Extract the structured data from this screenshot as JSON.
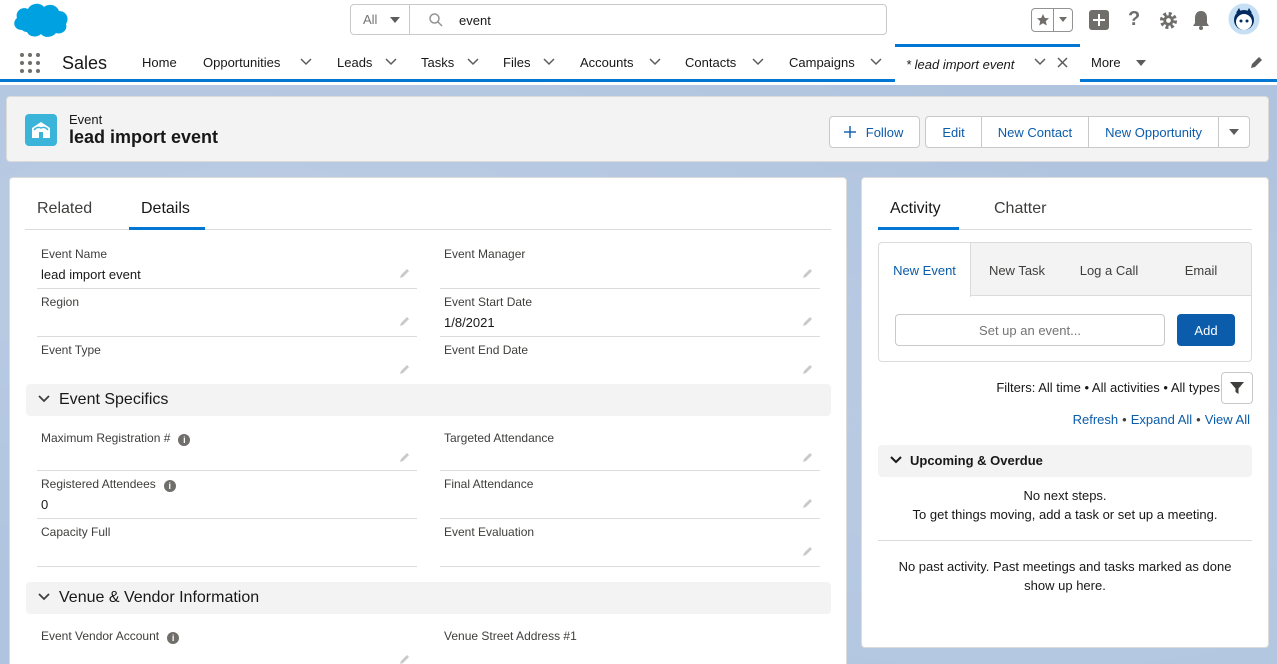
{
  "header": {
    "search_scope": "All",
    "search_value": "event"
  },
  "nav": {
    "app_name": "Sales",
    "items": [
      {
        "label": "Home"
      },
      {
        "label": "Opportunities"
      },
      {
        "label": "Leads"
      },
      {
        "label": "Tasks"
      },
      {
        "label": "Files"
      },
      {
        "label": "Accounts"
      },
      {
        "label": "Contacts"
      },
      {
        "label": "Campaigns"
      }
    ],
    "active_tab": "* lead import event",
    "more": "More"
  },
  "record": {
    "type": "Event",
    "title": "lead import event",
    "buttons": {
      "follow": "Follow",
      "edit": "Edit",
      "new_contact": "New Contact",
      "new_opportunity": "New Opportunity"
    }
  },
  "details": {
    "tabs": [
      "Related",
      "Details"
    ],
    "fields": {
      "event_name": {
        "label": "Event Name",
        "value": "lead import event"
      },
      "event_manager": {
        "label": "Event Manager",
        "value": ""
      },
      "region": {
        "label": "Region",
        "value": ""
      },
      "event_start_date": {
        "label": "Event Start Date",
        "value": "1/8/2021"
      },
      "event_type": {
        "label": "Event Type",
        "value": ""
      },
      "event_end_date": {
        "label": "Event End Date",
        "value": ""
      }
    },
    "section_specifics": {
      "title": "Event Specifics",
      "max_registration": {
        "label": "Maximum Registration #",
        "value": ""
      },
      "targeted_attendance": {
        "label": "Targeted Attendance",
        "value": ""
      },
      "registered_attendees": {
        "label": "Registered Attendees",
        "value": "0"
      },
      "final_attendance": {
        "label": "Final Attendance",
        "value": ""
      },
      "capacity_full": {
        "label": "Capacity Full",
        "value": ""
      },
      "event_evaluation": {
        "label": "Event Evaluation",
        "value": ""
      }
    },
    "section_venue": {
      "title": "Venue & Vendor Information",
      "vendor_account": {
        "label": "Event Vendor Account",
        "value": ""
      },
      "venue_street": {
        "label": "Venue Street Address #1",
        "value": ""
      }
    }
  },
  "activity": {
    "tabs": [
      "Activity",
      "Chatter"
    ],
    "publisher_tabs": [
      "New Event",
      "New Task",
      "Log a Call",
      "Email"
    ],
    "event_placeholder": "Set up an event...",
    "add_label": "Add",
    "filters": "Filters: All time • All activities • All types",
    "links": {
      "refresh": "Refresh",
      "expand_all": "Expand All",
      "view_all": "View All",
      "sep": "•"
    },
    "upcoming_title": "Upcoming & Overdue",
    "no_next_1": "No next steps.",
    "no_next_2": "To get things moving, add a task or set up a meeting.",
    "no_past_1": "No past activity. Past meetings and tasks marked as done",
    "no_past_2": "show up here."
  },
  "colors": {
    "brand": "#0176d3",
    "link": "#0b5cab",
    "event_icon": "#3ab4d8"
  }
}
